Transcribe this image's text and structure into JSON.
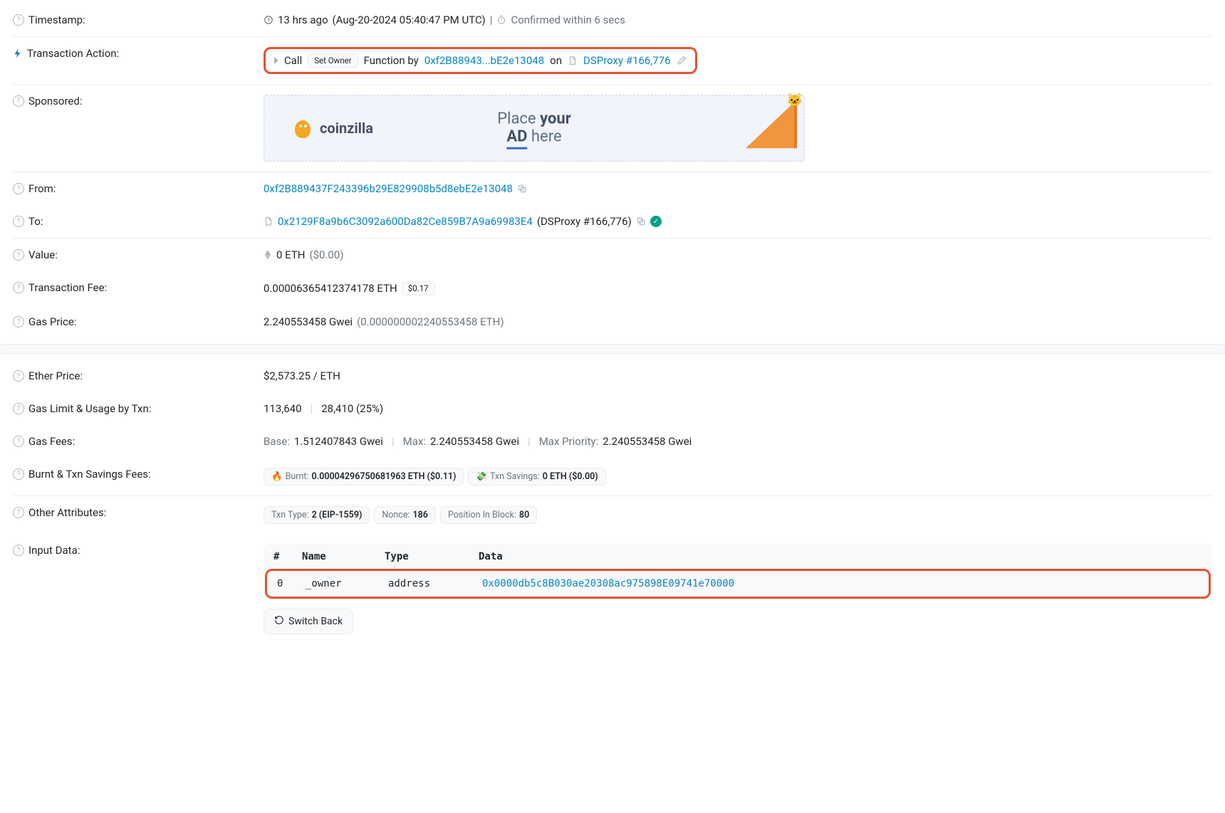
{
  "timestamp": {
    "label": "Timestamp:",
    "ago": "13 hrs ago",
    "full": "(Aug-20-2024 05:40:47 PM UTC)",
    "confirmed": "Confirmed within 6 secs"
  },
  "action": {
    "label": "Transaction Action:",
    "call": "Call",
    "method": "Set Owner",
    "function_by": "Function by",
    "address_short": "0xf2B88943...bE2e13048",
    "on": "on",
    "contract": "DSProxy #166,776"
  },
  "sponsored": {
    "label": "Sponsored:",
    "logo": "coinzilla",
    "line1_a": "Place",
    "line1_b": "your",
    "line2_a": "AD",
    "line2_b": "here"
  },
  "from": {
    "label": "From:",
    "address": "0xf2B889437F243396b29E829908b5d8ebE2e13048"
  },
  "to": {
    "label": "To:",
    "address": "0x2129F8a9b6C3092a600Da82Ce859B7A9a69983E4",
    "name": "(DSProxy #166,776)"
  },
  "value": {
    "label": "Value:",
    "amount": "0 ETH",
    "usd": "($0.00)"
  },
  "fee": {
    "label": "Transaction Fee:",
    "amount": "0.00006365412374178 ETH",
    "usd": "$0.17"
  },
  "gas_price": {
    "label": "Gas Price:",
    "amount": "2.240553458 Gwei",
    "eth": "(0.000000002240553458 ETH)"
  },
  "ether_price": {
    "label": "Ether Price:",
    "value": "$2,573.25 / ETH"
  },
  "gas_limit": {
    "label": "Gas Limit & Usage by Txn:",
    "limit": "113,640",
    "usage": "28,410 (25%)"
  },
  "gas_fees": {
    "label": "Gas Fees:",
    "base_l": "Base:",
    "base_v": "1.512407843 Gwei",
    "max_l": "Max:",
    "max_v": "2.240553458 Gwei",
    "maxp_l": "Max Priority:",
    "maxp_v": "2.240553458 Gwei"
  },
  "burnt": {
    "label": "Burnt & Txn Savings Fees:",
    "burnt_l": "Burnt:",
    "burnt_v": "0.00004296750681963 ETH ($0.11)",
    "save_l": "Txn Savings:",
    "save_v": "0 ETH ($0.00)"
  },
  "other": {
    "label": "Other Attributes:",
    "txn_type_l": "Txn Type:",
    "txn_type_v": "2 (EIP-1559)",
    "nonce_l": "Nonce:",
    "nonce_v": "186",
    "pos_l": "Position In Block:",
    "pos_v": "80"
  },
  "input": {
    "label": "Input Data:",
    "headers": {
      "idx": "#",
      "name": "Name",
      "type": "Type",
      "data": "Data"
    },
    "row": {
      "idx": "0",
      "name": "_owner",
      "type": "address",
      "data": "0x0000db5c8B030ae20308ac975898E09741e70000"
    },
    "switch": "Switch Back"
  }
}
